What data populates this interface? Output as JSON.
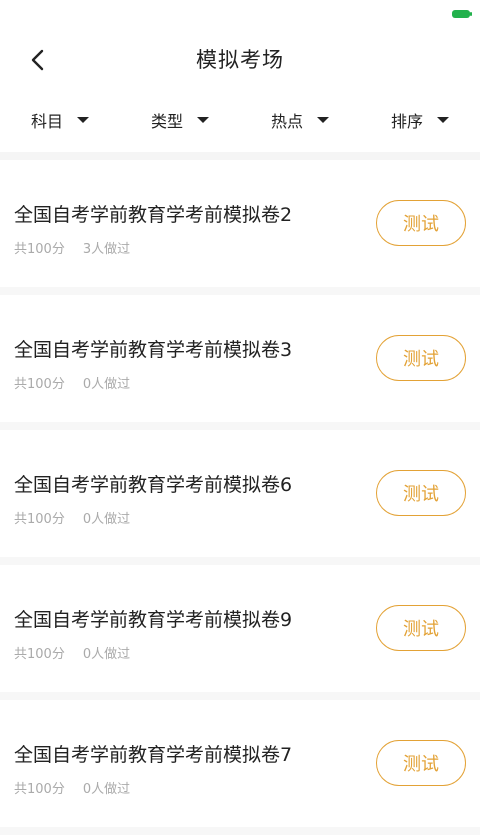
{
  "header": {
    "title": "模拟考场"
  },
  "filters": [
    {
      "label": "科目"
    },
    {
      "label": "类型"
    },
    {
      "label": "热点"
    },
    {
      "label": "排序"
    }
  ],
  "exams": [
    {
      "title": "全国自考学前教育学考前模拟卷2",
      "score": "共100分",
      "takers": "3人做过",
      "action": "测试"
    },
    {
      "title": "全国自考学前教育学考前模拟卷3",
      "score": "共100分",
      "takers": "0人做过",
      "action": "测试"
    },
    {
      "title": "全国自考学前教育学考前模拟卷6",
      "score": "共100分",
      "takers": "0人做过",
      "action": "测试"
    },
    {
      "title": "全国自考学前教育学考前模拟卷9",
      "score": "共100分",
      "takers": "0人做过",
      "action": "测试"
    },
    {
      "title": "全国自考学前教育学考前模拟卷7",
      "score": "共100分",
      "takers": "0人做过",
      "action": "测试"
    }
  ],
  "colors": {
    "accent": "#e3a236",
    "battery": "#22b14c"
  },
  "icons": {
    "back": "chevron-left-icon",
    "dropdown": "caret-down-icon",
    "battery": "battery-icon"
  }
}
